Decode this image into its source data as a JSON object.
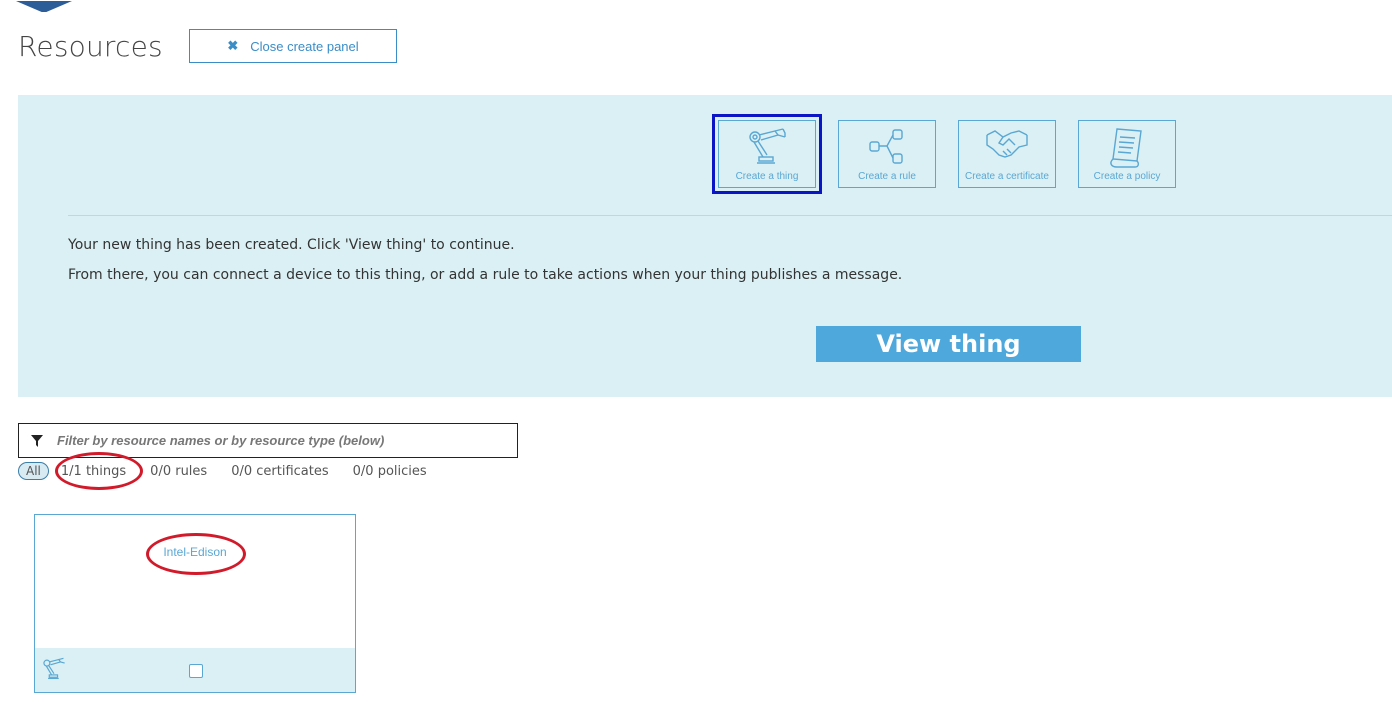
{
  "page": {
    "title": "Resources"
  },
  "header": {
    "close_panel_label": "Close create panel"
  },
  "create_panel": {
    "tiles": [
      {
        "label": "Create a thing",
        "icon": "robot-arm-icon",
        "selected": true
      },
      {
        "label": "Create a rule",
        "icon": "rule-branch-icon",
        "selected": false
      },
      {
        "label": "Create a certificate",
        "icon": "handshake-icon",
        "selected": false
      },
      {
        "label": "Create a policy",
        "icon": "policy-document-icon",
        "selected": false
      }
    ],
    "message_line1": "Your new thing has been created. Click 'View thing' to continue.",
    "message_line2": "From there, you can connect a device to this thing, or add a rule to take actions when your thing publishes a message.",
    "view_button_label": "View thing"
  },
  "filter": {
    "placeholder": "Filter by resource names or by resource type (below)",
    "icon": "filter-icon"
  },
  "type_tabs": {
    "all": "All",
    "things": "1/1 things",
    "rules": "0/0 rules",
    "certificates": "0/0 certificates",
    "policies": "0/0 policies"
  },
  "resources": [
    {
      "name": "Intel-Edison",
      "type_icon": "robot-arm-icon",
      "selected": false
    }
  ],
  "colors": {
    "accent": "#4fa8dc",
    "panel_bg": "#dbf0f4",
    "selected_outline": "#0a16c6",
    "annotation_ring": "#d11a2a"
  }
}
